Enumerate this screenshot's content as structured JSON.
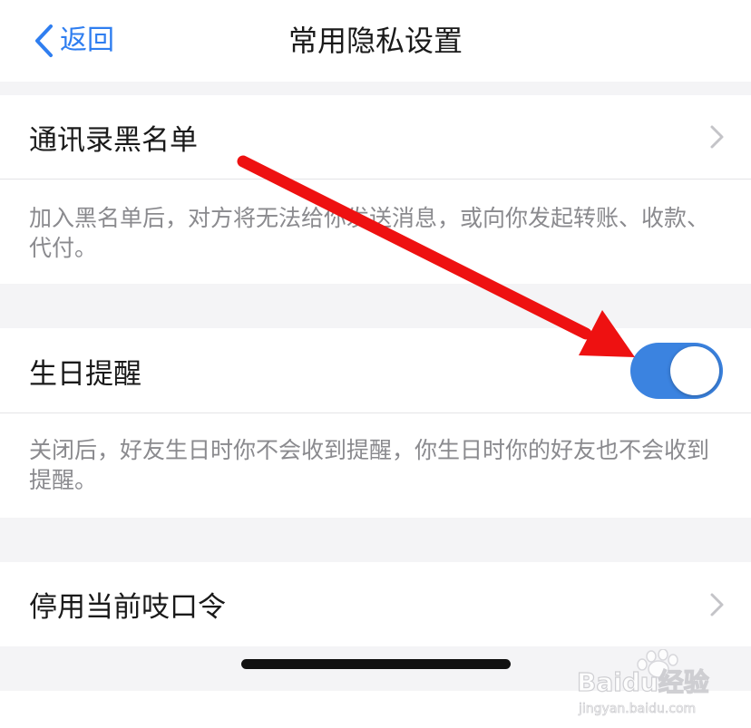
{
  "nav": {
    "back_label": "返回",
    "title": "常用隐私设置"
  },
  "rows": {
    "blacklist": {
      "label": "通讯录黑名单",
      "description": "加入黑名单后，对方将无法给你发送消息，或向你发起转账、收款、代付。"
    },
    "birthday": {
      "label": "生日提醒",
      "toggle_on": true,
      "description": "关闭后，好友生日时你不会收到提醒，你生日时你的好友也不会收到提醒。"
    },
    "disable_code": {
      "label": "停用当前吱口令"
    }
  },
  "watermark": {
    "brand": "Baidu经验",
    "url": "jingyan.baidu.com"
  },
  "colors": {
    "accent": "#3b83e0",
    "back": "#2f7ef0",
    "arrow": "#ee1111",
    "background": "#f4f4f6"
  },
  "icons": {
    "back": "chevron-left-icon",
    "row_arrow": "chevron-right-icon"
  }
}
